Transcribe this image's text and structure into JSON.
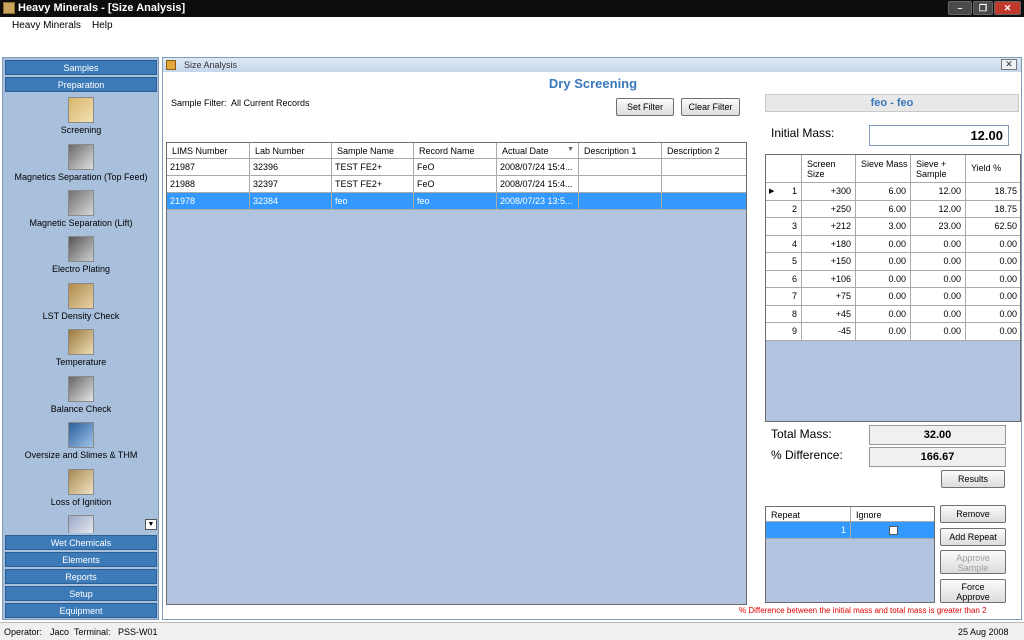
{
  "window": {
    "title": "Heavy Minerals - [Size Analysis]"
  },
  "menu": {
    "items": [
      "Heavy Minerals",
      "Help"
    ]
  },
  "sidebar": {
    "top_headers": [
      "Samples",
      "Preparation"
    ],
    "items": [
      "Screening",
      "Magnetics Separation (Top Feed)",
      "Magnetic Separation (Lift)",
      "Electro Plating",
      "LST Density Check",
      "Temperature",
      "Balance Check",
      "Oversize and Slimes & THM",
      "Loss of Ignition"
    ],
    "bottom_headers": [
      "Wet Chemicals",
      "Elements",
      "Reports",
      "Setup",
      "Equipment"
    ]
  },
  "child": {
    "title": "Size Analysis",
    "heading": "Dry Screening",
    "filter_label": "Sample Filter:",
    "filter_value": "All Current Records",
    "set_filter": "Set Filter",
    "clear_filter": "Clear Filter"
  },
  "records": {
    "headers": [
      "LIMS Number",
      "Lab Number",
      "Sample Name",
      "Record Name",
      "Actual Date",
      "Description 1",
      "Description 2"
    ],
    "rows": [
      [
        "21987",
        "32396",
        "TEST FE2+",
        "FeO",
        "2008/07/24 15:4...",
        "",
        ""
      ],
      [
        "21988",
        "32397",
        "TEST FE2+",
        "FeO",
        "2008/07/24 15:4...",
        "",
        ""
      ],
      [
        "21978",
        "32384",
        "feo",
        "feo",
        "2008/07/23 13:5...",
        "",
        ""
      ]
    ]
  },
  "sample_panel": {
    "title": "feo - feo",
    "initial_mass_label": "Initial Mass:",
    "initial_mass": "12.00",
    "headers": [
      "Screen Size",
      "Sieve Mass",
      "Sieve + Sample",
      "Yield %"
    ],
    "rows": [
      [
        "1",
        "+300",
        "6.00",
        "12.00",
        "18.75"
      ],
      [
        "2",
        "+250",
        "6.00",
        "12.00",
        "18.75"
      ],
      [
        "3",
        "+212",
        "3.00",
        "23.00",
        "62.50"
      ],
      [
        "4",
        "+180",
        "0.00",
        "0.00",
        "0.00"
      ],
      [
        "5",
        "+150",
        "0.00",
        "0.00",
        "0.00"
      ],
      [
        "6",
        "+106",
        "0.00",
        "0.00",
        "0.00"
      ],
      [
        "7",
        "+75",
        "0.00",
        "0.00",
        "0.00"
      ],
      [
        "8",
        "+45",
        "0.00",
        "0.00",
        "0.00"
      ],
      [
        "9",
        "-45",
        "0.00",
        "0.00",
        "0.00"
      ]
    ],
    "total_mass_label": "Total Mass:",
    "total_mass": "32.00",
    "pct_diff_label": "% Difference:",
    "pct_diff": "166.67",
    "results": "Results",
    "repeat_headers": [
      "Repeat",
      "Ignore"
    ],
    "repeat_value": "1",
    "remove": "Remove",
    "add_repeat": "Add Repeat",
    "approve_sample": "Approve Sample",
    "force_approve": "Force Approve",
    "warning": "% Difference between the initial mass and total mass is greater than 2"
  },
  "status": {
    "operator_label": "Operator:",
    "operator": "Jaco",
    "terminal_label": "Terminal:",
    "terminal": "PSS-W01",
    "date": "25 Aug 2008"
  },
  "colors": {
    "accent": "#3a78bd",
    "selection": "#3399ff",
    "warning": "#e00000",
    "grid_bg": "#b2c4df"
  }
}
